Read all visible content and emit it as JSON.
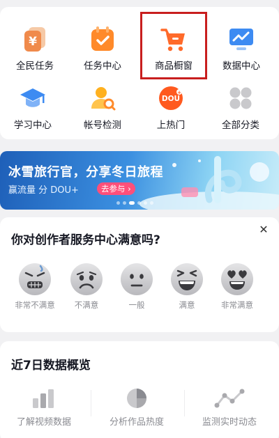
{
  "services": {
    "items": [
      {
        "label": "全民任务",
        "icon": "yuan-coin-icon"
      },
      {
        "label": "任务中心",
        "icon": "task-calendar-icon"
      },
      {
        "label": "商品橱窗",
        "icon": "shopping-cart-icon"
      },
      {
        "label": "数据中心",
        "icon": "chart-monitor-icon"
      },
      {
        "label": "学习中心",
        "icon": "graduation-cap-icon"
      },
      {
        "label": "帐号检测",
        "icon": "account-check-icon"
      },
      {
        "label": "上热门",
        "icon": "dou-plus-icon"
      },
      {
        "label": "全部分类",
        "icon": "grid-icon"
      }
    ],
    "highlight_color": "#c81e1e"
  },
  "banner": {
    "title": "冰雪旅行官，分享冬日旅程",
    "subtitle": "赢流量 分 DOU+",
    "cta": "去参与",
    "active_dot": 2,
    "dot_count": 6
  },
  "survey": {
    "title": "你对创作者服务中心满意吗?",
    "close_icon": "close-icon",
    "options": [
      {
        "label": "非常不满意",
        "icon": "very-dissatisfied-face-icon"
      },
      {
        "label": "不满意",
        "icon": "dissatisfied-face-icon"
      },
      {
        "label": "一般",
        "icon": "neutral-face-icon"
      },
      {
        "label": "满意",
        "icon": "satisfied-face-icon"
      },
      {
        "label": "非常满意",
        "icon": "heart-eyes-face-icon"
      }
    ]
  },
  "stats": {
    "title": "近7日数据概览",
    "items": [
      {
        "label": "了解视频数据",
        "icon": "bar-chart-icon"
      },
      {
        "label": "分析作品热度",
        "icon": "pie-chart-icon"
      },
      {
        "label": "监测实时动态",
        "icon": "line-trend-icon"
      }
    ]
  },
  "colors": {
    "accent_orange": "#ff8a2a",
    "accent_blue": "#3d8bf2",
    "highlight_red": "#c81e1e"
  }
}
